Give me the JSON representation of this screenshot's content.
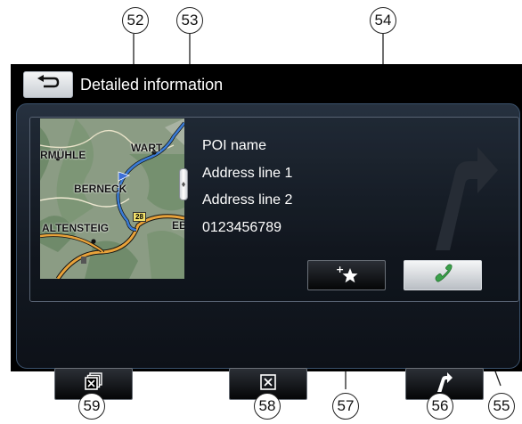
{
  "header": {
    "title": "Detailed information",
    "back_icon": "return-arrow-icon"
  },
  "map": {
    "labels": [
      "RMÜHLE",
      "WART",
      "BERNECK",
      "ALTENSTEIG",
      "EB"
    ],
    "road_number": "28"
  },
  "poi": {
    "name": "POI name",
    "address_line_1": "Address line 1",
    "address_line_2": "Address line 2",
    "phone": "0123456789"
  },
  "actions": {
    "favorite_icon": "add-favorite-star-icon",
    "call_icon": "phone-handset-icon"
  },
  "bottom_bar": {
    "left_icon": "close-all-icon",
    "center_icon": "close-icon",
    "right_icon": "turn-right-route-icon"
  },
  "callouts": {
    "c52": "52",
    "c53": "53",
    "c54": "54",
    "c55": "55",
    "c56": "56",
    "c57": "57",
    "c58": "58",
    "c59": "59"
  },
  "colors": {
    "screen_bg": "#000000",
    "panel_border": "#39506a",
    "call_icon": "#3aa04a",
    "route_line": "#2f6fe0"
  }
}
